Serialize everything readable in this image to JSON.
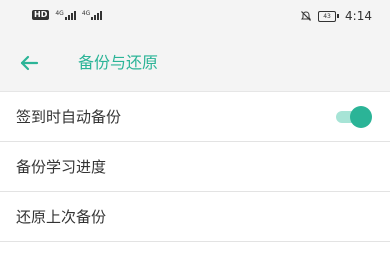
{
  "status_bar": {
    "hd": "HD",
    "signal1": "4G",
    "signal2": "4G",
    "battery": "43",
    "time": "4:14",
    "icons": [
      "mute-icon",
      "battery-icon",
      "signal-icon"
    ]
  },
  "header": {
    "title": "备份与还原",
    "back_icon": "arrow-left-icon"
  },
  "settings": [
    {
      "label": "签到时自动备份",
      "toggle": true
    },
    {
      "label": "备份学习进度"
    },
    {
      "label": "还原上次备份"
    }
  ],
  "colors": {
    "accent": "#2bb497",
    "toggle_track": "#a7e4d6"
  }
}
